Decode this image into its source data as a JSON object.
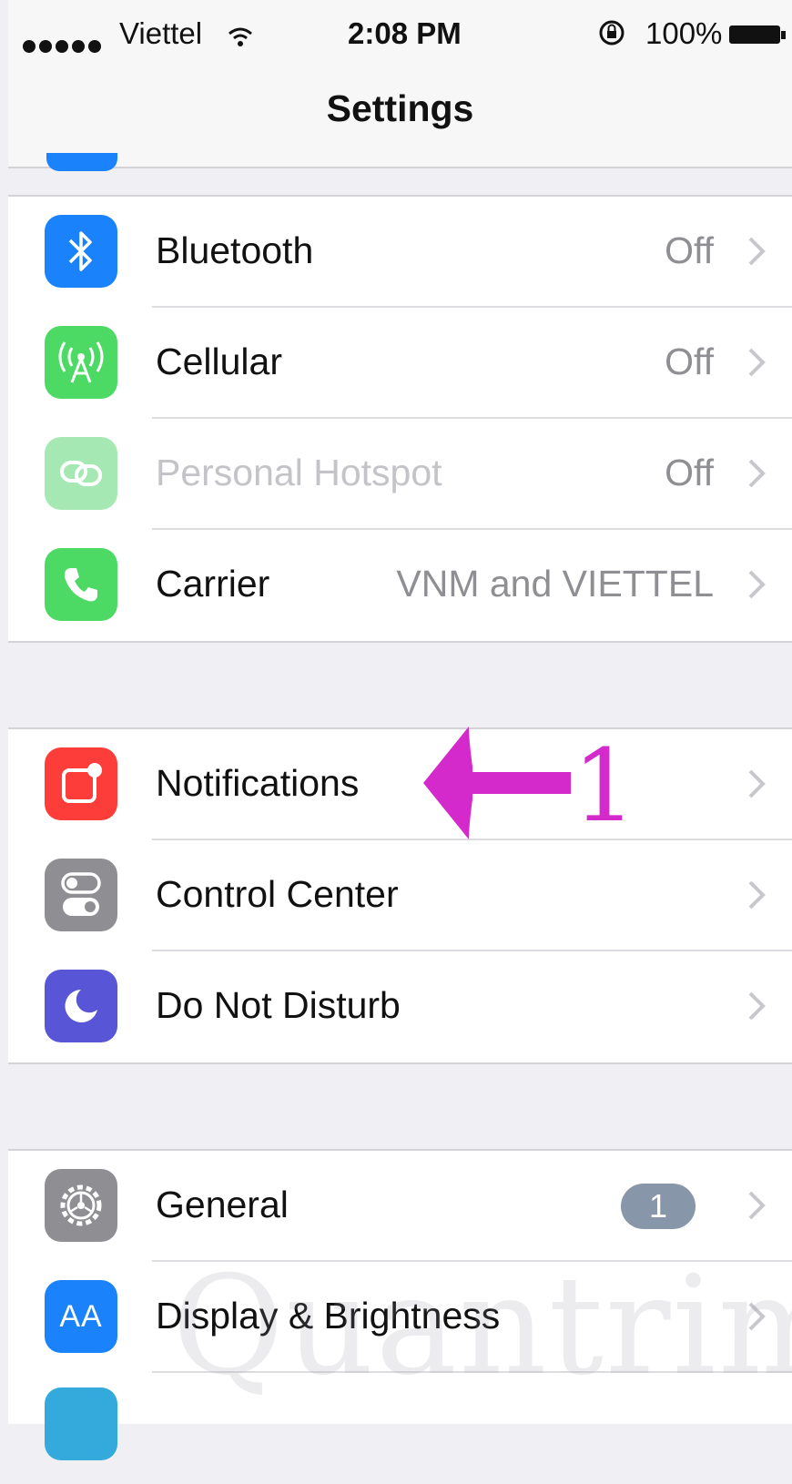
{
  "status_bar": {
    "carrier": "Viettel",
    "time": "2:08 PM",
    "battery": "100%"
  },
  "nav": {
    "title": "Settings"
  },
  "groups": [
    {
      "rows": [
        {
          "label": "Bluetooth",
          "value": "Off",
          "icon": "bluetooth-icon",
          "color": "#1a82fb"
        },
        {
          "label": "Cellular",
          "value": "Off",
          "icon": "cellular-antenna-icon",
          "color": "#4cd964"
        },
        {
          "label": "Personal Hotspot",
          "value": "Off",
          "icon": "hotspot-link-icon",
          "color": "#a6e8b3",
          "disabled": true
        },
        {
          "label": "Carrier",
          "value": "VNM and VIETTEL",
          "icon": "phone-icon",
          "color": "#4cd964"
        }
      ]
    },
    {
      "rows": [
        {
          "label": "Notifications",
          "icon": "notifications-icon",
          "color": "#fc3d39"
        },
        {
          "label": "Control Center",
          "icon": "control-center-icon",
          "color": "#8e8e93"
        },
        {
          "label": "Do Not Disturb",
          "icon": "moon-icon",
          "color": "#5856d6"
        }
      ]
    },
    {
      "rows": [
        {
          "label": "General",
          "badge": "1",
          "icon": "gear-icon",
          "color": "#8e8e93"
        },
        {
          "label": "Display & Brightness",
          "icon": "text-size-icon",
          "color": "#1a82fb",
          "icon_text": "AA"
        }
      ]
    }
  ],
  "annotation": {
    "number": "1",
    "color": "#d52acb"
  },
  "watermark": "Quantrimang"
}
